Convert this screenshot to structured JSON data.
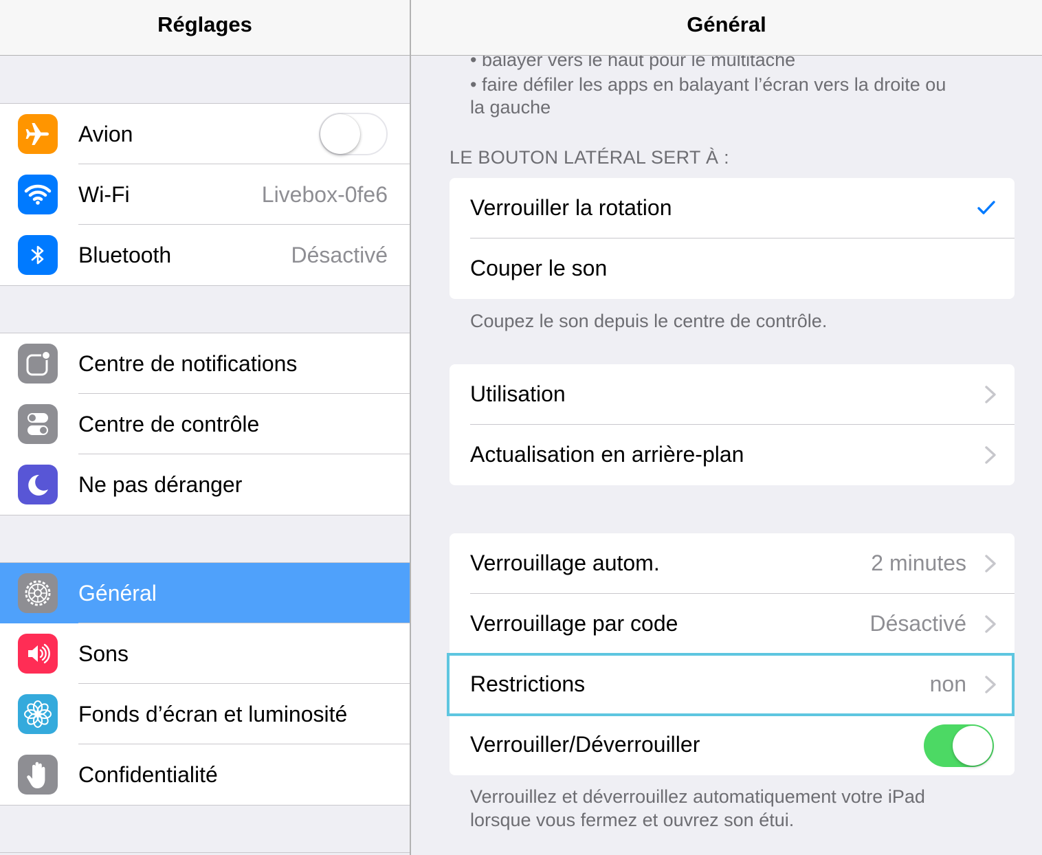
{
  "left": {
    "title": "Réglages",
    "groups": [
      {
        "items": [
          {
            "name": "avion",
            "label": "Avion",
            "icon": "airplane-icon",
            "color": "#ff9500",
            "toggle": false
          },
          {
            "name": "wifi",
            "label": "Wi-Fi",
            "icon": "wifi-icon",
            "color": "#007aff",
            "value": "Livebox-0fe6"
          },
          {
            "name": "bluetooth",
            "label": "Bluetooth",
            "icon": "bluetooth-icon",
            "color": "#007aff",
            "value": "Désactivé"
          }
        ]
      },
      {
        "items": [
          {
            "name": "notifications",
            "label": "Centre de notifications",
            "icon": "notification-center-icon",
            "color": "#8e8e93"
          },
          {
            "name": "control-center",
            "label": "Centre de contrôle",
            "icon": "control-center-icon",
            "color": "#8e8e93"
          },
          {
            "name": "do-not-disturb",
            "label": "Ne pas déranger",
            "icon": "moon-icon",
            "color": "#5856d6"
          }
        ]
      },
      {
        "items": [
          {
            "name": "general",
            "label": "Général",
            "icon": "gear-icon",
            "color": "#8e8e93",
            "selected": true
          },
          {
            "name": "sons",
            "label": "Sons",
            "icon": "speaker-icon",
            "color": "#ff2d55"
          },
          {
            "name": "wallpaper",
            "label": "Fonds d’écran et luminosité",
            "icon": "flower-icon",
            "color": "#34aadc"
          },
          {
            "name": "privacy",
            "label": "Confidentialité",
            "icon": "hand-icon",
            "color": "#8e8e93"
          }
        ]
      }
    ]
  },
  "right": {
    "title": "Général",
    "overflow_lines": [
      "• balayer vers le haut pour le multitâche",
      "• faire défiler les apps en balayant l’écran vers la droite ou",
      "la gauche"
    ],
    "side_switch": {
      "header": "LE BOUTON LATÉRAL SERT À :",
      "items": [
        {
          "label": "Verrouiller la rotation",
          "checked": true
        },
        {
          "label": "Couper le son",
          "checked": false
        }
      ],
      "footer": "Coupez le son depuis le centre de contrôle."
    },
    "usage_group": {
      "items": [
        {
          "label": "Utilisation"
        },
        {
          "label": "Actualisation en arrière-plan"
        }
      ]
    },
    "lock_group": {
      "items": [
        {
          "label": "Verrouillage autom.",
          "value": "2 minutes"
        },
        {
          "label": "Verrouillage par code",
          "value": "Désactivé"
        },
        {
          "label": "Restrictions",
          "value": "non",
          "highlighted": true
        },
        {
          "label": "Verrouiller/Déverrouiller",
          "toggle": true
        }
      ],
      "footer": "Verrouillez et déverrouillez automatiquement votre iPad lorsque vous fermez et ouvrez son étui."
    }
  },
  "colors": {
    "selected_row": "#4fa1fb",
    "checkmark": "#007aff",
    "toggle_on": "#4cd964",
    "highlight_outline": "#5ec6e0"
  }
}
